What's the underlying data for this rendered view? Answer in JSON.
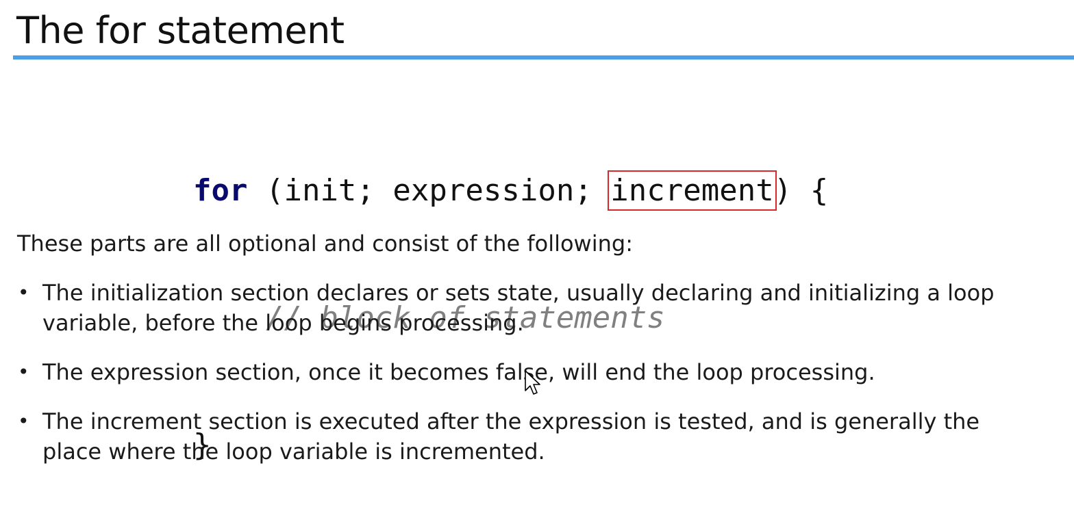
{
  "slide": {
    "title": "The for statement"
  },
  "code": {
    "line1": {
      "keyword": "for",
      "open": " (init; expression; ",
      "highlighted": "increment",
      "close": ") {"
    },
    "line2": {
      "indent": "    ",
      "comment": "// block of statements"
    },
    "line3": "}"
  },
  "content": {
    "intro": "These parts are all optional and consist of the following:",
    "bullets": [
      {
        "text": "The initialization section declares or sets state, usually declaring and initializing a loop variable, before the loop begins processing."
      },
      {
        "text": "The expression section, once it becomes false, will end the loop processing."
      },
      {
        "text": "The increment section is executed after the expression is tested, and is generally the place where the loop variable is incremented."
      }
    ],
    "bullet_glyph": "•"
  },
  "colors": {
    "title_rule": "#4a9fe8",
    "keyword": "#0a0a6e",
    "comment": "#808080",
    "highlight_box": "#d62828"
  },
  "icons": {
    "cursor": "mouse-pointer-icon"
  }
}
